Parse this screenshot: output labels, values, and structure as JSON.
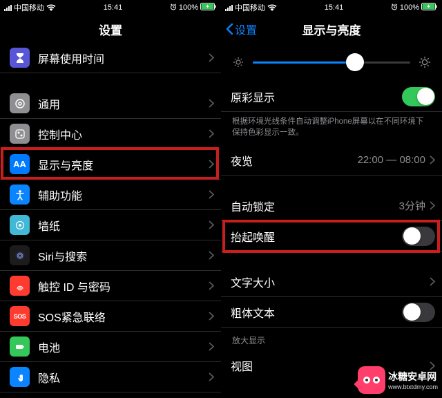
{
  "status": {
    "carrier": "中国移动",
    "time": "15:41",
    "battery": "100%"
  },
  "left": {
    "title": "设置",
    "items": {
      "screentime": "屏幕使用时间",
      "general": "通用",
      "control": "控制中心",
      "display": "显示与亮度",
      "accessibility": "辅助功能",
      "wallpaper": "墙纸",
      "siri": "Siri与搜索",
      "touchid": "触控 ID 与密码",
      "sos": "SOS紧急联络",
      "sos_icon": "SOS",
      "battery": "电池",
      "privacy": "隐私"
    }
  },
  "right": {
    "back": "设置",
    "title": "显示与亮度",
    "truetone": {
      "label": "原彩显示",
      "on": true
    },
    "truetone_desc": "根据环境光线条件自动调整iPhone屏幕以在不同环境下保持色彩显示一致。",
    "nightshift": {
      "label": "夜览",
      "value": "22:00 — 08:00"
    },
    "autolock": {
      "label": "自动锁定",
      "value": "3分钟"
    },
    "raisewake": {
      "label": "抬起唤醒",
      "on": false
    },
    "textsize": "文字大小",
    "boldtext": {
      "label": "粗体文本",
      "on": false
    },
    "zoom_header": "放大显示",
    "zoom_view": "视图",
    "brightness_pct": 65
  },
  "watermark": {
    "text": "冰糖安卓网",
    "url": "www.btxtdmy.com"
  }
}
